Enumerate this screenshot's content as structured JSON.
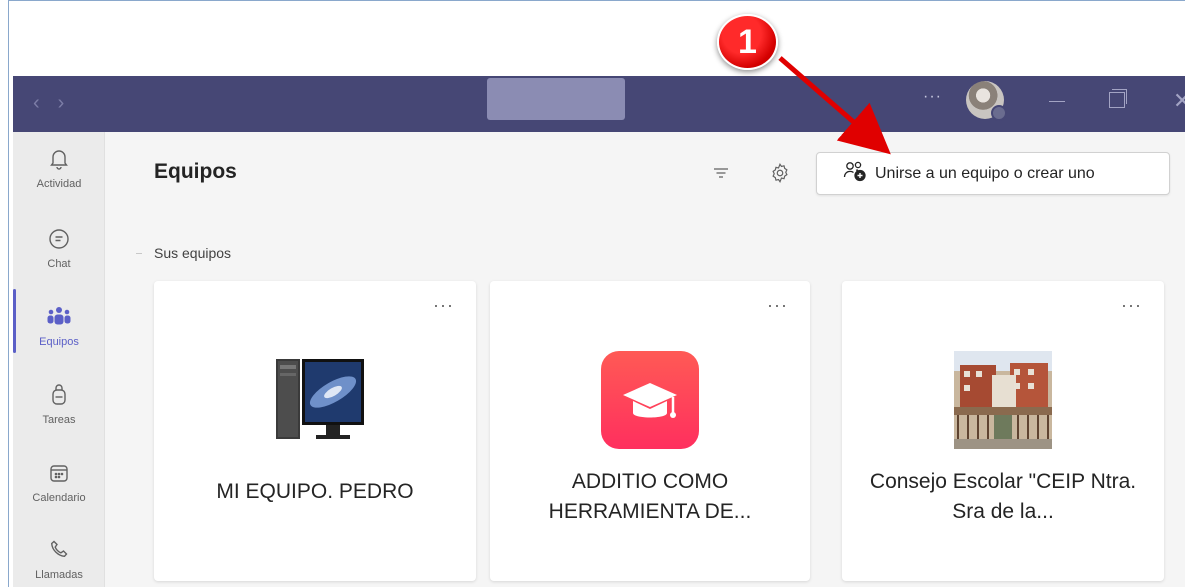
{
  "page": {
    "title": "Equipos",
    "section_label": "Sus equipos"
  },
  "titlebar": {
    "more_label": "···"
  },
  "rail": {
    "items": [
      {
        "label": "Actividad",
        "icon": "bell-icon"
      },
      {
        "label": "Chat",
        "icon": "chat-icon"
      },
      {
        "label": "Equipos",
        "icon": "teams-icon",
        "active": true
      },
      {
        "label": "Tareas",
        "icon": "backpack-icon"
      },
      {
        "label": "Calendario",
        "icon": "calendar-icon"
      },
      {
        "label": "Llamadas",
        "icon": "phone-icon"
      }
    ]
  },
  "toolbar": {
    "join_label": "Unirse a un equipo o crear uno"
  },
  "teams": [
    {
      "name": "MI EQUIPO. PEDRO",
      "more_label": "···",
      "image": "computer-image"
    },
    {
      "name": "ADDITIO COMO HERRAMIENTA DE...",
      "more_label": "···",
      "image": "graduation-cap-app-icon"
    },
    {
      "name": "Consejo Escolar \"CEIP Ntra. Sra de la...",
      "more_label": "···",
      "image": "school-building-photo"
    }
  ],
  "annotation": {
    "badge_label": "1"
  },
  "colors": {
    "titlebar": "#464775",
    "accent": "#5b5fc7",
    "annotation": "#e00000"
  }
}
